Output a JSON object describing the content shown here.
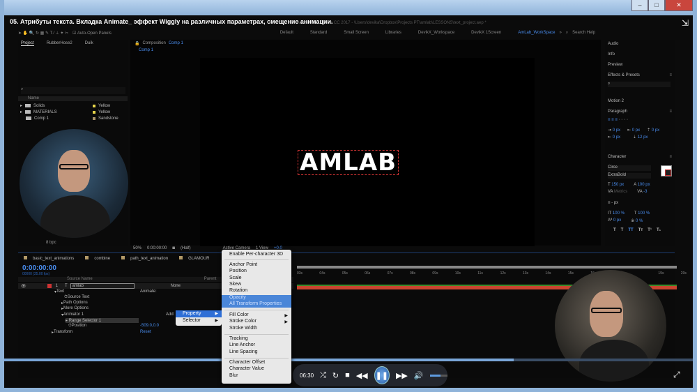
{
  "video_title": "05. Атрибуты текста. Вкладка Animate_ эффект Wiggly на различных параметрах, смещение анимации.",
  "app_path": "Adobe After Effects CC 2017 - \\Users\\devika\\Dropbox\\Projects PT\\amlab\\LESSONS\\text_project.aep *",
  "toolbar": {
    "auto_open": "Auto-Open Panels",
    "workspaces": [
      "Default",
      "Standard",
      "Small Screen",
      "Libraries",
      "DevikX_Workspace",
      "DevikX 1Screen",
      "AmLab_WorkSpace"
    ],
    "search": "Search Help"
  },
  "project": {
    "tabs": [
      "Project",
      "RubberHose2",
      "Duik"
    ],
    "name_col": "Name",
    "items": [
      {
        "name": "Solids",
        "label": "Yellow",
        "color": "#e5d34a"
      },
      {
        "name": "MATERIALS",
        "label": "Yellow",
        "color": "#e5d34a"
      },
      {
        "name": "Comp 1",
        "label": "Sandstone",
        "color": "#a8926a"
      }
    ],
    "bpc": "8 bpc"
  },
  "composition": {
    "header": "Composition",
    "name": "Comp 1",
    "tab": "Comp 1",
    "text": "AMLAB"
  },
  "viewer_bar": {
    "zoom": "50%",
    "time": "0:00:00:00",
    "view": "(Half)",
    "camera": "Active Camera",
    "views": "1 View",
    "exposure": "+0.0"
  },
  "right_panel": {
    "audio": "Audio",
    "info": "Info",
    "preview": "Preview",
    "effects": "Effects & Presets",
    "motion": "Motion 2",
    "paragraph": "Paragraph",
    "para_vals": [
      "0 px",
      "0 px",
      "0 px",
      "0 px",
      "12 px"
    ],
    "character": "Character",
    "font": "Circe",
    "style": "ExtraBold",
    "size": "150 px",
    "leading": "100 px",
    "kerning": "Metrics",
    "tracking": "-3",
    "stroke": "- px",
    "vscale": "100 %",
    "hscale": "100 %",
    "baseline": "0 px",
    "tsume": "0 %",
    "styles": [
      "T",
      "T",
      "TT",
      "Tт",
      "T¹",
      "T₁"
    ]
  },
  "timeline": {
    "tabs": [
      "basic_text_animations",
      "combine",
      "path_text_animation",
      "GLAMOUR"
    ],
    "time": "0:00:00:00",
    "fps": "00000 (25.00 fps)",
    "source_name": "Source Name",
    "parent": "Parent",
    "layer_num": "1",
    "layer_name": "amlab",
    "parent_val": "None",
    "rows": [
      "Text",
      "Source Text",
      "Path Options",
      "More Options",
      "Animator 1",
      "Range Selector 1",
      "Position",
      "Transform"
    ],
    "animate": "Animate:",
    "add": "Add:",
    "position_val": "-509.0,0.0",
    "reset": "Reset",
    "ticks": [
      "03s",
      "04s",
      "05s",
      "06s",
      "07s",
      "08s",
      "09s",
      "10s",
      "11s",
      "12s",
      "13s",
      "14s",
      "15s",
      "16s",
      "19s",
      "20s"
    ]
  },
  "context_menu": {
    "items": [
      "Enable Per-character 3D",
      "Anchor Point",
      "Position",
      "Scale",
      "Skew",
      "Rotation",
      "Opacity",
      "All Transform Properties",
      "Fill Color",
      "Stroke Color",
      "Stroke Width",
      "Tracking",
      "Line Anchor",
      "Line Spacing",
      "Character Offset",
      "Character Value",
      "Blur"
    ]
  },
  "submenu": {
    "items": [
      "Property",
      "Selector"
    ]
  },
  "player": {
    "time": "06:30",
    "progress": 0.74,
    "volume": 0.6
  }
}
